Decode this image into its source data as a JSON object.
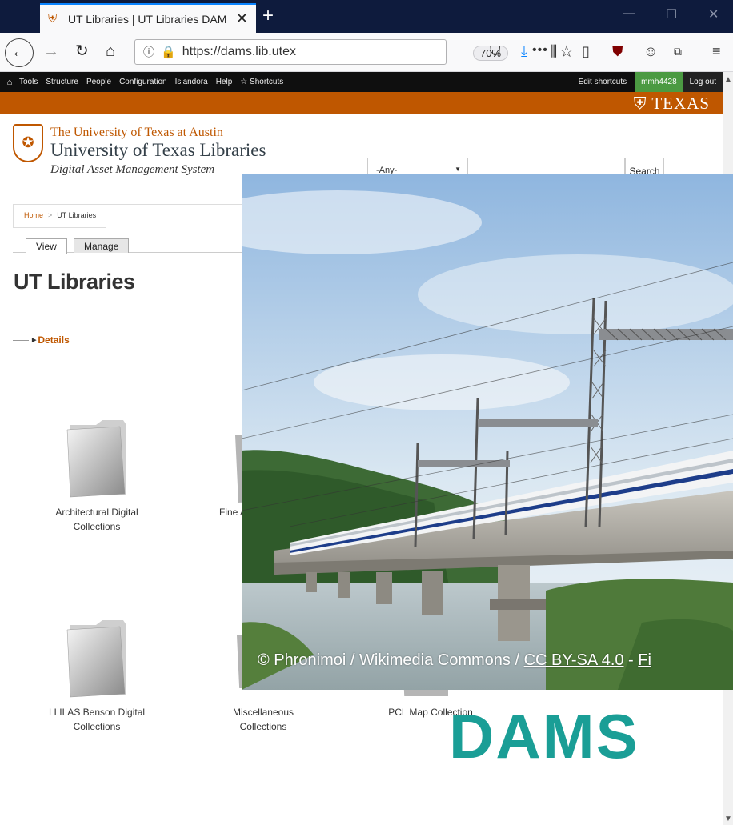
{
  "browser": {
    "tab_title": "UT Libraries | UT Libraries DAM",
    "url": "https://dams.lib.utex",
    "zoom": "70%",
    "url_more": "•••"
  },
  "admin_toolbar": {
    "items": [
      "Tools",
      "Structure",
      "People",
      "Configuration",
      "Islandora",
      "Help",
      "Shortcuts"
    ],
    "edit_shortcuts": "Edit shortcuts",
    "user": "mmh4428",
    "logout": "Log out"
  },
  "banner": {
    "logo_text": "TEXAS"
  },
  "header": {
    "line1": "The University of Texas at Austin",
    "line2": "University of Texas Libraries",
    "line3": "Digital Asset Management System"
  },
  "search": {
    "select_value": "-Any-",
    "button": "Search"
  },
  "breadcrumb": {
    "home": "Home",
    "current": "UT Libraries"
  },
  "tabs": {
    "view": "View",
    "manage": "Manage"
  },
  "page": {
    "title": "UT Libraries",
    "details": "Details"
  },
  "collections": [
    {
      "label_line1": "Architectural Digital",
      "label_line2": "Collections"
    },
    {
      "label_line1": "Fine A",
      "label_line2": ""
    },
    {
      "label_line1": "LLILAS Benson Digital",
      "label_line2": "Collections"
    },
    {
      "label_line1": "Miscellaneous",
      "label_line2": "Collections"
    },
    {
      "label_line1": "PCL Map Collection",
      "label_line2": ""
    }
  ],
  "overlay": {
    "caption_prefix": "© Phronimoi / Wikimedia Commons / ",
    "caption_license": "CC BY-SA 4.0",
    "caption_sep": " - ",
    "caption_tail": "Fi",
    "brand": "DAMS"
  },
  "colors": {
    "ut_orange": "#bf5700",
    "admin_green": "#4b9a42",
    "dams_teal": "#1a9e96"
  }
}
